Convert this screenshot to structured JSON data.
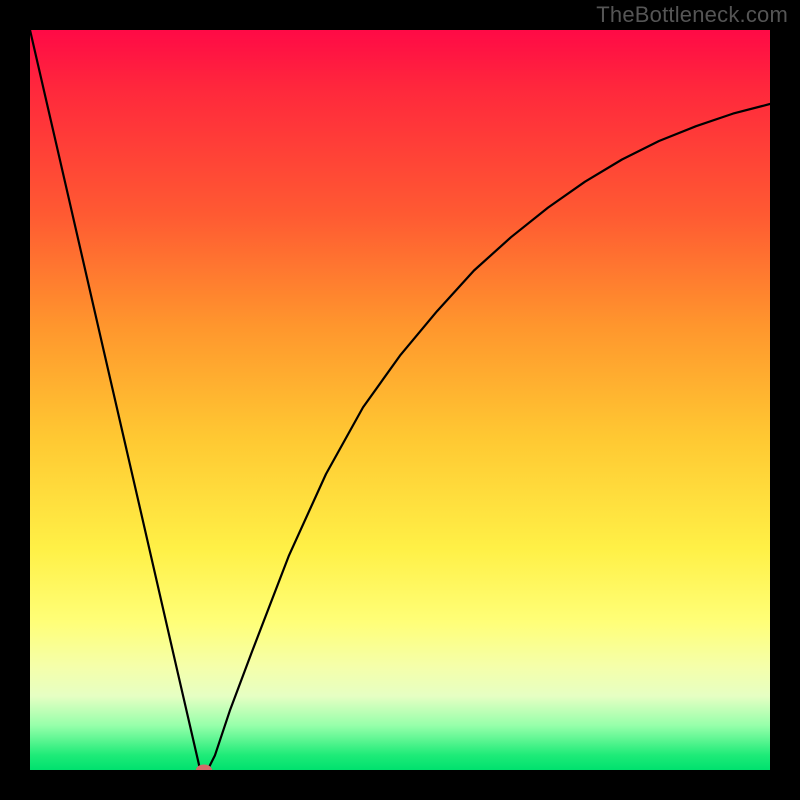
{
  "watermark": "TheBottleneck.com",
  "chart_data": {
    "type": "line",
    "title": "",
    "xlabel": "",
    "ylabel": "",
    "xlim": [
      0,
      100
    ],
    "ylim": [
      0,
      100
    ],
    "grid": false,
    "legend": false,
    "series": [
      {
        "name": "curve",
        "x": [
          0,
          5,
          10,
          15,
          20,
          23,
          24,
          25,
          27,
          30,
          35,
          40,
          45,
          50,
          55,
          60,
          65,
          70,
          75,
          80,
          85,
          90,
          95,
          100
        ],
        "y": [
          100,
          78.3,
          56.5,
          34.8,
          13.0,
          0,
          0,
          2,
          8,
          16,
          29,
          40,
          49,
          56,
          62,
          67.5,
          72,
          76,
          79.5,
          82.5,
          85,
          87,
          88.7,
          90
        ]
      }
    ],
    "marker": {
      "x": 23.5,
      "y": 0
    },
    "gradient_stops": [
      {
        "pct": 0,
        "color": "#ff0a46"
      },
      {
        "pct": 8,
        "color": "#ff283c"
      },
      {
        "pct": 25,
        "color": "#ff5a32"
      },
      {
        "pct": 40,
        "color": "#ff962d"
      },
      {
        "pct": 55,
        "color": "#ffc832"
      },
      {
        "pct": 70,
        "color": "#fff046"
      },
      {
        "pct": 80,
        "color": "#ffff78"
      },
      {
        "pct": 86,
        "color": "#f5ffaa"
      },
      {
        "pct": 90,
        "color": "#e6ffc3"
      },
      {
        "pct": 94,
        "color": "#96ffaa"
      },
      {
        "pct": 98,
        "color": "#1eeb78"
      },
      {
        "pct": 100,
        "color": "#00e16e"
      }
    ]
  }
}
